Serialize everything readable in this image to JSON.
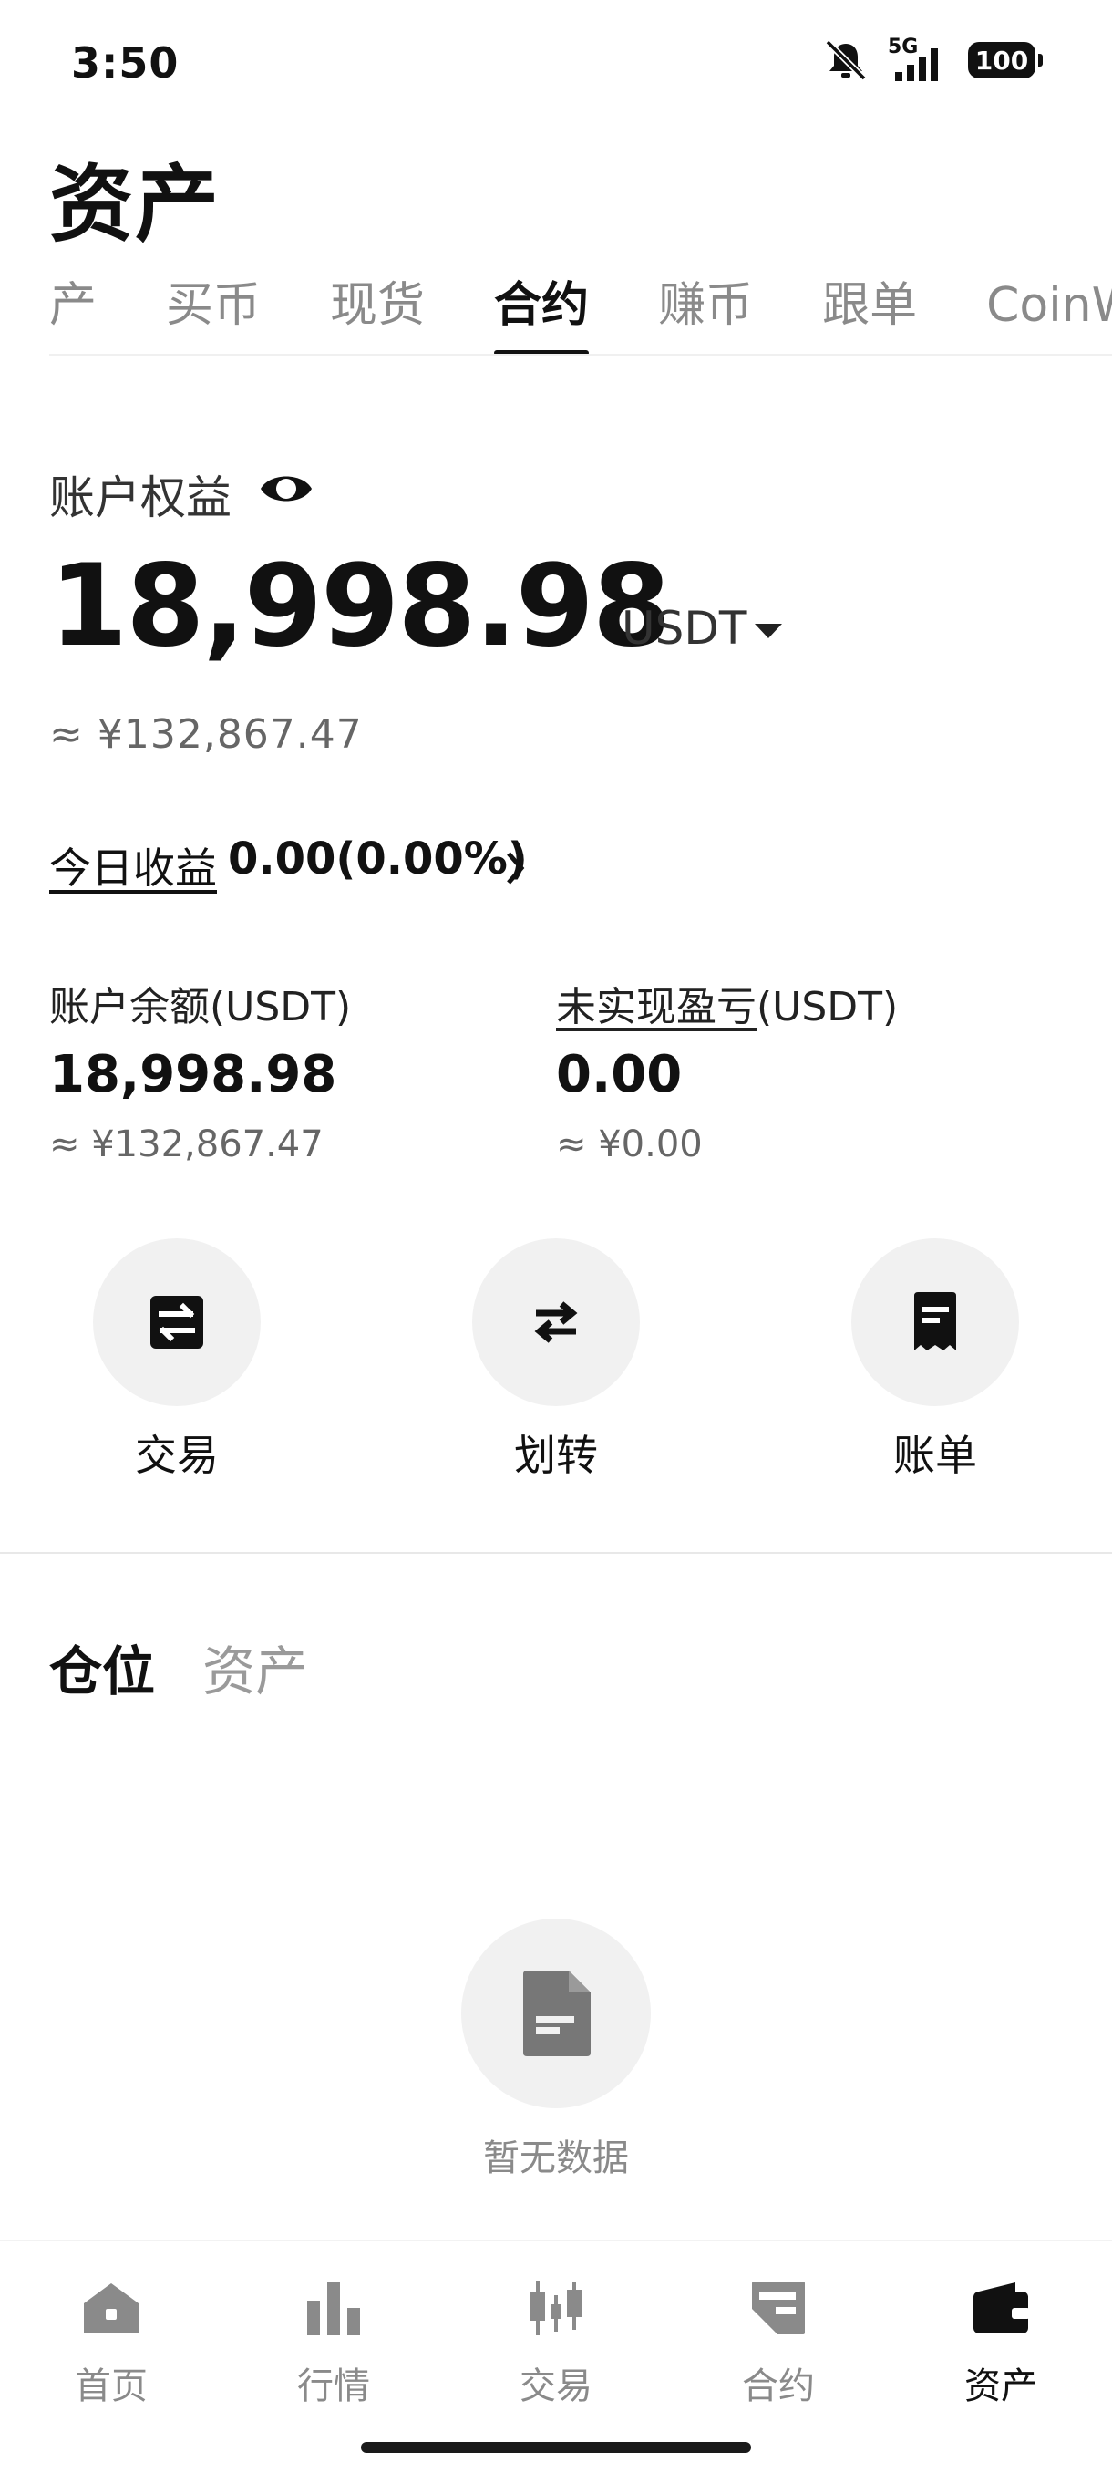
{
  "status_bar": {
    "time": "3:50",
    "network": "5G",
    "battery": "100"
  },
  "page_title": "资产",
  "tabs": [
    "产",
    "买币",
    "现货",
    "合约",
    "赚币",
    "跟单",
    "CoinW"
  ],
  "account": {
    "equity_label": "账户权益",
    "equity_value": "18,998.98",
    "unit": "USDT",
    "equity_cny": "≈ ¥132,867.47",
    "today_label": "今日收益",
    "today_value": "0.00(0.00%)",
    "balance_label": "账户余额(USDT)",
    "balance_value": "18,998.98",
    "balance_cny": "≈ ¥132,867.47",
    "pnl_label_link": "未实现盈亏",
    "pnl_label_unit": "(USDT)",
    "pnl_value": "0.00",
    "pnl_cny": "≈ ¥0.00"
  },
  "actions": {
    "trade": "交易",
    "transfer": "划转",
    "bill": "账单"
  },
  "sub_tabs": {
    "positions": "仓位",
    "assets": "资产"
  },
  "empty_state": "暂无数据",
  "bottom_nav": {
    "home": "首页",
    "market": "行情",
    "trade": "交易",
    "futures": "合约",
    "assets": "资产"
  },
  "colors": {
    "text": "#111111",
    "muted": "#8a8a8a",
    "circle_bg": "#f1f1f1"
  }
}
